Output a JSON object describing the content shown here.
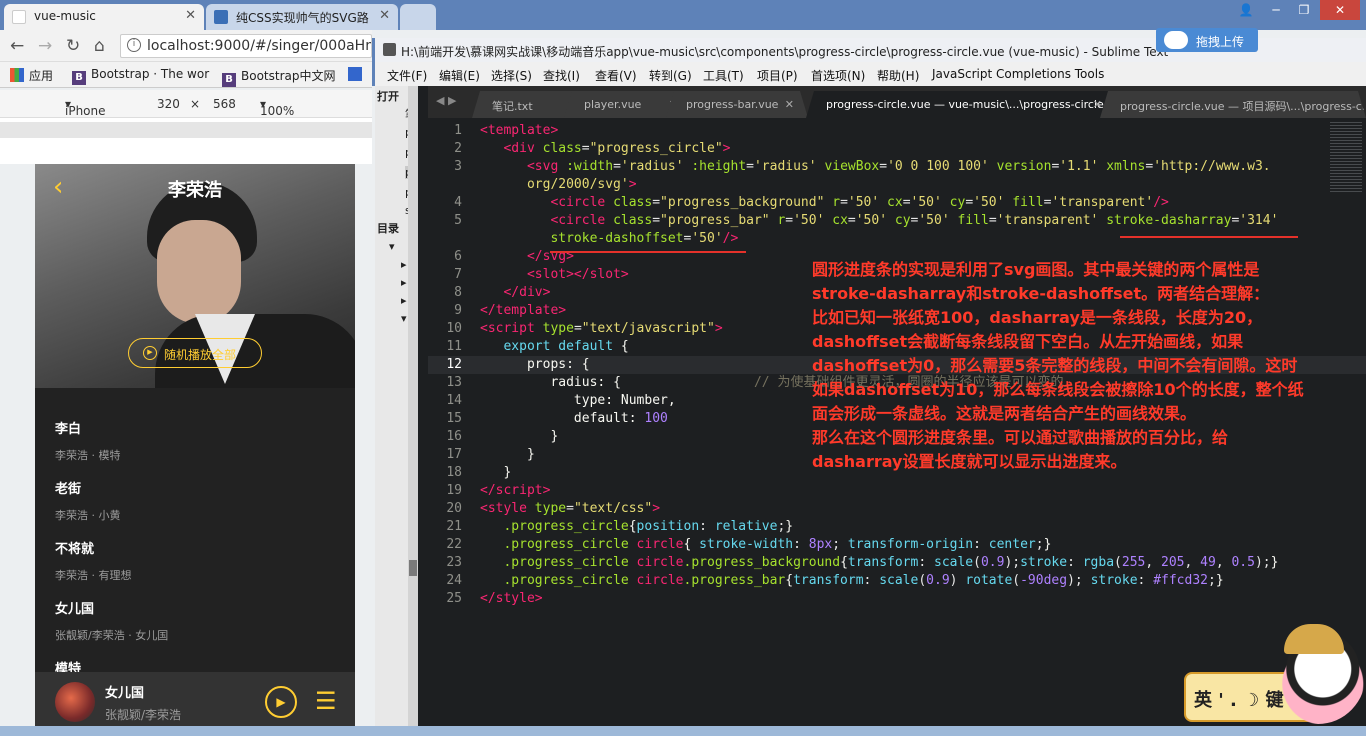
{
  "browser": {
    "tabs": [
      {
        "title": "vue-music",
        "active": true
      },
      {
        "title": "纯CSS实现帅气的SVG路",
        "active": false
      },
      {
        "title": "",
        "active": false
      }
    ],
    "url": "localhost:9000/#/singer/000aHm",
    "bookmarks": [
      "应用",
      "Bootstrap · The wor",
      "Bootstrap中文网"
    ],
    "device": {
      "name": "iPhone 5",
      "width": "320",
      "times": "×",
      "height": "568",
      "zoom": "100%"
    }
  },
  "phone": {
    "singer": "李荣浩",
    "play_all": "随机播放全部",
    "songs": [
      {
        "name": "李白",
        "desc": "李荣浩 · 模特"
      },
      {
        "name": "老街",
        "desc": "李荣浩 · 小黄"
      },
      {
        "name": "不将就",
        "desc": "李荣浩 · 有理想"
      },
      {
        "name": "女儿国",
        "desc": "张靓颖/李荣浩 · 女儿国"
      },
      {
        "name": "模特",
        "desc": ""
      }
    ],
    "mini": {
      "name": "女儿国",
      "desc": "张靓颖/李荣浩"
    }
  },
  "sublime": {
    "title": "H:\\前端开发\\慕课网实战课\\移动端音乐app\\vue-music\\src\\components\\progress-circle\\progress-circle.vue (vue-music) - Sublime Text",
    "upload": "拖拽上传",
    "menu": [
      "文件(F)",
      "编辑(E)",
      "选择(S)",
      "查找(I)",
      "查看(V)",
      "转到(G)",
      "工具(T)",
      "项目(P)",
      "首选项(N)",
      "帮助(H)",
      "JavaScript Completions Tools"
    ],
    "sidebar": [
      "打开",
      "笔",
      "p",
      "p",
      "p",
      "p",
      "so",
      "目录"
    ],
    "tabs": [
      "笔记.txt",
      "player.vue",
      "progress-bar.vue",
      "progress-circle.vue — vue-music\\...\\progress-circle",
      "progress-circle.vue — 项目源码\\...\\progress-circle"
    ],
    "line_numbers": [
      "1",
      "2",
      "3",
      "",
      "4",
      "5",
      "",
      "6",
      "7",
      "8",
      "9",
      "10",
      "11",
      "12",
      "13",
      "14",
      "15",
      "16",
      "17",
      "18",
      "19",
      "20",
      "21",
      "22",
      "23",
      "24",
      "25"
    ],
    "comment": "// 为使基础组件更灵活，圆圈的半径应该是可以变的",
    "annotation": [
      "圆形进度条的实现是利用了svg画图。其中最关键的两个属性是",
      "stroke-dasharray和stroke-dashoffset。两者结合理解：",
      "比如已知一张纸宽100，dasharray是一条线段，长度为20，",
      "dashoffset会截断每条线段留下空白。从左开始画线，如果",
      "dashoffset为0，那么需要5条完整的线段，中间不会有间隙。这时",
      "如果dashoffset为10，那么每条线段会被擦除10个的长度，整个纸",
      "面会形成一条虚线。这就是两者结合产生的画线效果。",
      "那么在这个圆形进度条里。可以通过歌曲播放的百分比，给",
      "dasharray设置长度就可以显示出进度来。"
    ]
  },
  "ime": {
    "text": "英 ' . ☽ 键"
  }
}
